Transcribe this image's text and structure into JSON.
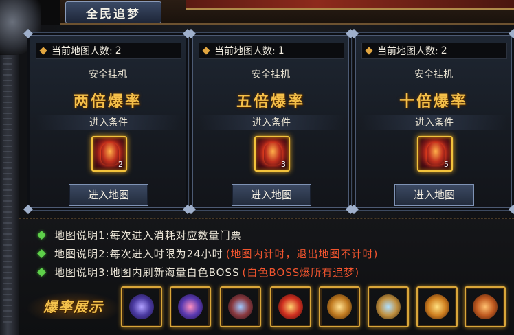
{
  "header": {
    "title": "全民追梦"
  },
  "cards": [
    {
      "count_label": "当前地图人数:",
      "count": "2",
      "mode": "安全挂机",
      "rate": "两倍爆率",
      "condition": "进入条件",
      "item_qty": "2",
      "button": "进入地图"
    },
    {
      "count_label": "当前地图人数:",
      "count": "1",
      "mode": "安全挂机",
      "rate": "五倍爆率",
      "condition": "进入条件",
      "item_qty": "3",
      "button": "进入地图"
    },
    {
      "count_label": "当前地图人数:",
      "count": "2",
      "mode": "安全挂机",
      "rate": "十倍爆率",
      "condition": "进入条件",
      "item_qty": "5",
      "button": "进入地图"
    }
  ],
  "info": {
    "lines": [
      {
        "text": "地图说明1:每次进入消耗对应数量门票",
        "extra": ""
      },
      {
        "text": "地图说明2:每次进入时限为24小时",
        "extra": "(地图内计时，退出地图不计时)"
      },
      {
        "text": "地图说明3:地图内刷新海量白色BOSS",
        "extra": "(白色BOSS爆所有追梦)"
      }
    ],
    "showcase_label": "爆率展示"
  },
  "colors": {
    "accent_gold": "#f5c04a",
    "note_red": "#f0542e",
    "bullet_green": "#5ed04a"
  }
}
